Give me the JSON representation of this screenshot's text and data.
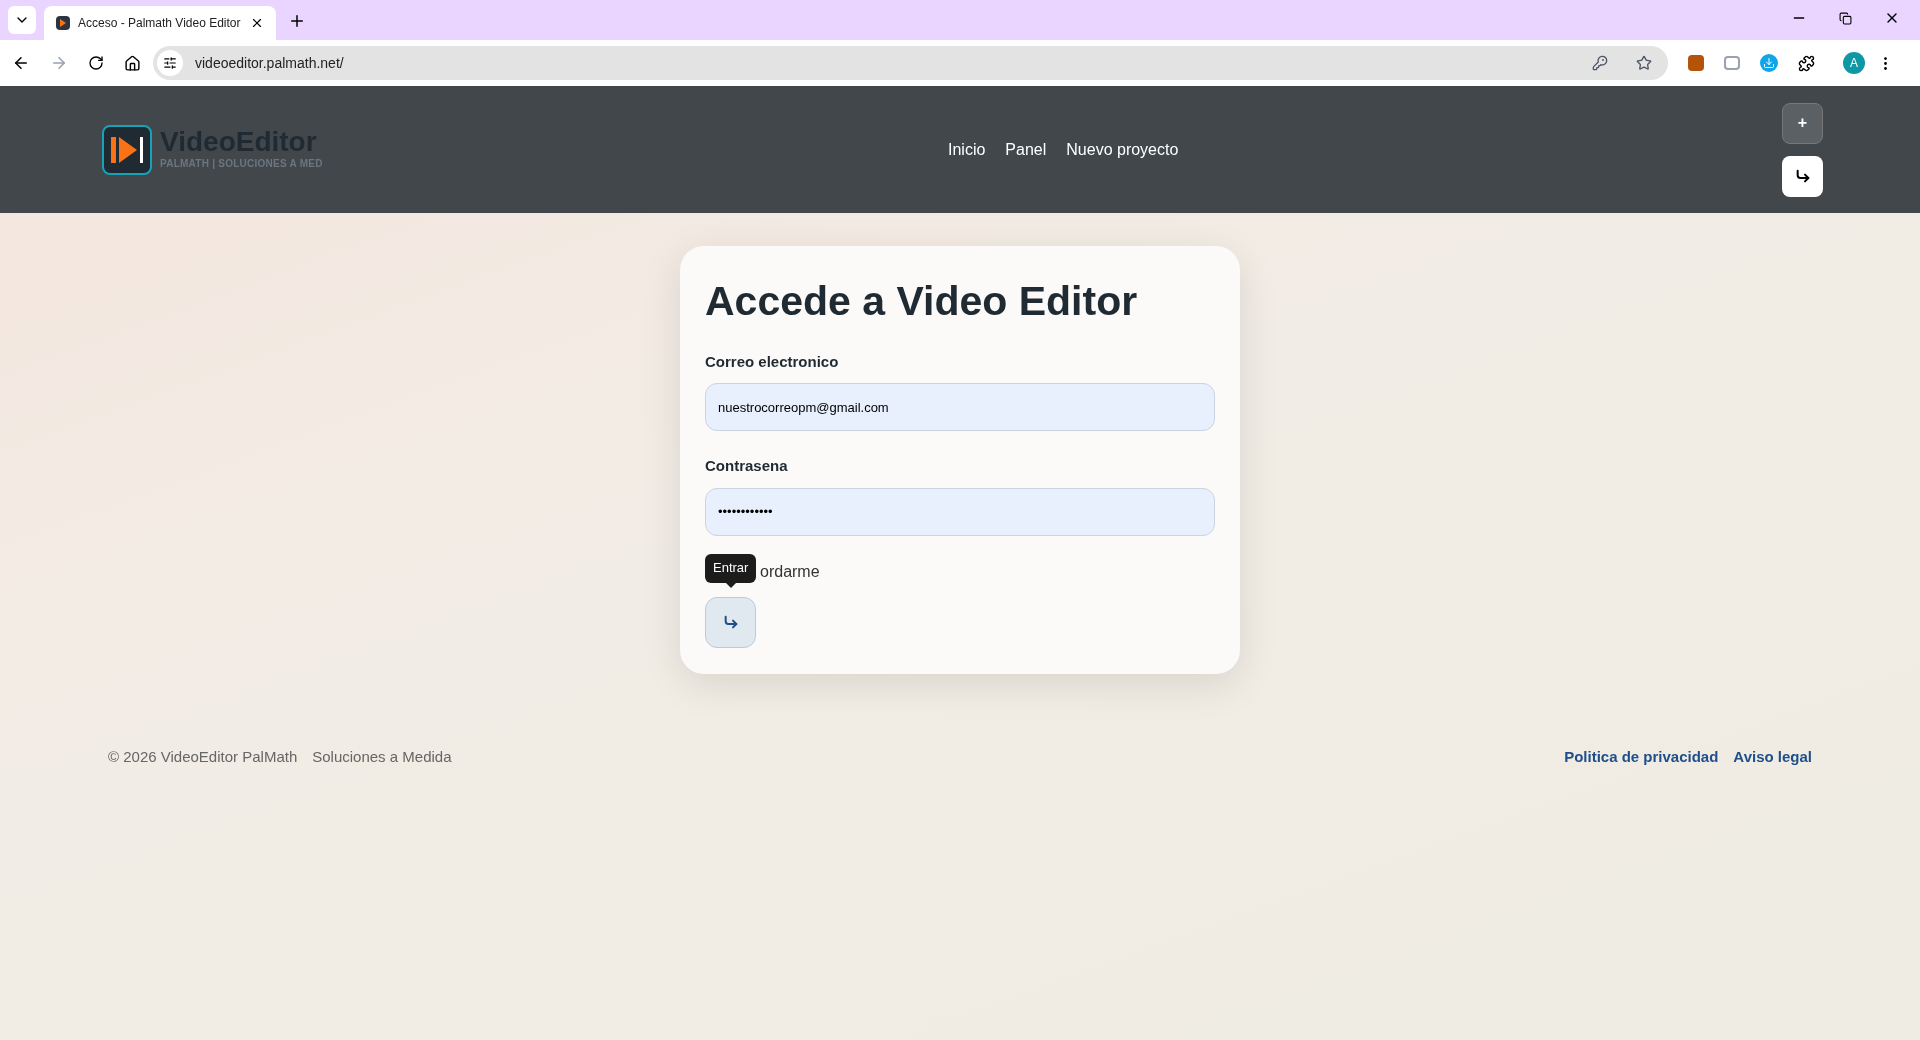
{
  "browser": {
    "tab_title": "Acceso - Palmath Video Editor",
    "url": "videoeditor.palmath.net/",
    "profile_initial": "A"
  },
  "header": {
    "brand": "VideoEditor",
    "tagline": "PALMATH | SOLUCIONES A MED",
    "nav": [
      {
        "label": "Inicio"
      },
      {
        "label": "Panel"
      },
      {
        "label": "Nuevo proyecto"
      }
    ],
    "buttons": [
      {
        "label": "+"
      }
    ]
  },
  "login": {
    "title": "Accede a Video Editor",
    "fields": [
      {
        "label": "Correo electronico",
        "value": "nuestrocorreopm@gmail.com"
      },
      {
        "label": "Contrasena",
        "value": "••••••••••••"
      }
    ],
    "remember": {
      "label": "ordarme"
    },
    "tooltip": "Entrar"
  },
  "footer": {
    "copyright": "© 2026 VideoEditor PalMath",
    "slogan": "Soluciones a Medida",
    "links": [
      "Politica de privacidad",
      "Aviso legal"
    ]
  }
}
